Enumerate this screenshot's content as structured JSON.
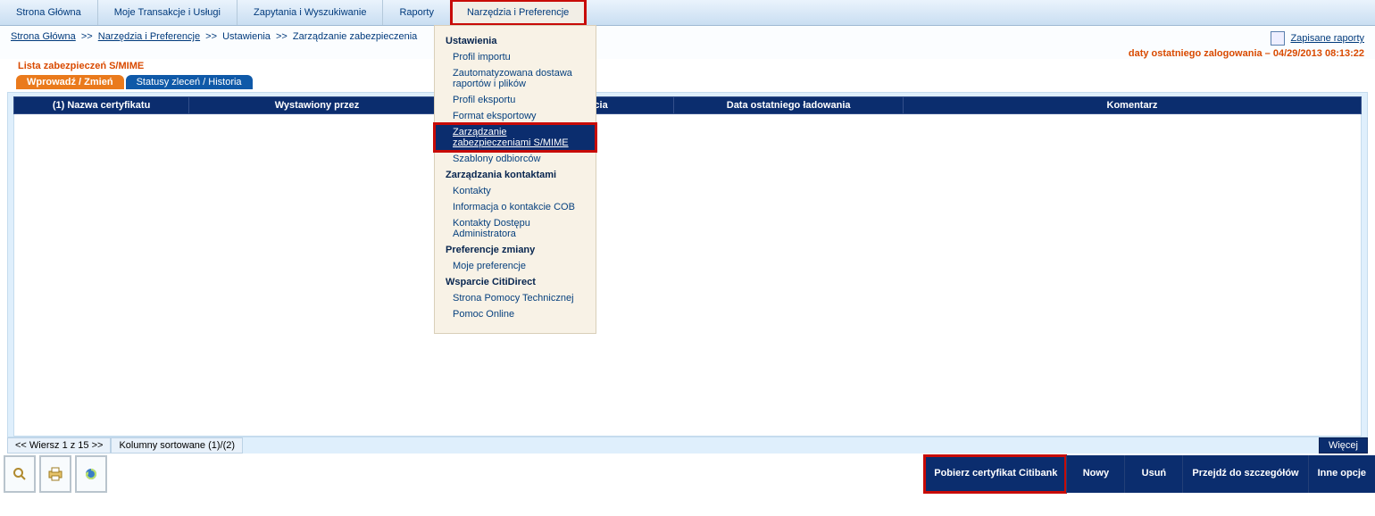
{
  "topnav": [
    {
      "label": "Strona Główna",
      "name": "nav-home"
    },
    {
      "label": "Moje Transakcje i Usługi",
      "name": "nav-transactions"
    },
    {
      "label": "Zapytania i Wyszukiwanie",
      "name": "nav-queries"
    },
    {
      "label": "Raporty",
      "name": "nav-reports"
    },
    {
      "label": "Narzędzia i Preferencje",
      "name": "nav-tools",
      "boxed": true
    }
  ],
  "breadcrumb": {
    "home": "Strona Główna",
    "sep": ">>",
    "l1": "Narzędzia i Preferencje",
    "l2": "Ustawienia",
    "l3": "Zarządzanie zabezpieczenia"
  },
  "saved_reports_label": "Zapisane raporty",
  "last_login": "daty ostatniego zalogowania – 04/29/2013 08:13:22",
  "page_title": "Lista zabezpieczeń S/MIME",
  "tabs": [
    {
      "label": "Wprowadź / Zmień",
      "style": "orange",
      "name": "tab-edit"
    },
    {
      "label": "Statusy zleceń / Historia",
      "style": "blue",
      "name": "tab-history"
    }
  ],
  "columns": [
    "(1) Nazwa certyfikatu",
    "Wystawiony przez",
    "(2) Data wygaśnięcia",
    "Data ostatniego ładowania",
    "Komentarz"
  ],
  "status": {
    "rows": "<< Wiersz 1 z 15 >>",
    "sort": "Kolumny sortowane (1)/(2)",
    "more": "Więcej"
  },
  "action_buttons": [
    {
      "label": "Pobierz certyfikat Citibank",
      "name": "btn-download-cert",
      "wide": true,
      "boxed": true
    },
    {
      "label": "Nowy",
      "name": "btn-new"
    },
    {
      "label": "Usuń",
      "name": "btn-delete"
    },
    {
      "label": "Przejdź do szczegółów",
      "name": "btn-details",
      "wide": true
    },
    {
      "label": "Inne opcje",
      "name": "btn-more"
    }
  ],
  "menu": {
    "sections": [
      {
        "title": "Ustawienia",
        "items": [
          {
            "label": "Profil importu"
          },
          {
            "label": "Zautomatyzowana dostawa raportów i plików"
          },
          {
            "label": "Profil eksportu"
          },
          {
            "label": "Format eksportowy"
          },
          {
            "label": "Zarządzanie zabezpieczeniami S/MIME",
            "selected": true
          },
          {
            "label": "Szablony odbiorców"
          }
        ]
      },
      {
        "title": "Zarządzania kontaktami",
        "items": [
          {
            "label": "Kontakty"
          },
          {
            "label": "Informacja o kontakcie COB"
          },
          {
            "label": "Kontakty Dostępu Administratora"
          }
        ]
      },
      {
        "title": "Preferencje zmiany",
        "items": [
          {
            "label": "Moje preferencje"
          }
        ]
      },
      {
        "title": "Wsparcie CitiDirect",
        "items": [
          {
            "label": "Strona Pomocy Technicznej"
          },
          {
            "label": "Pomoc Online"
          }
        ]
      }
    ]
  }
}
